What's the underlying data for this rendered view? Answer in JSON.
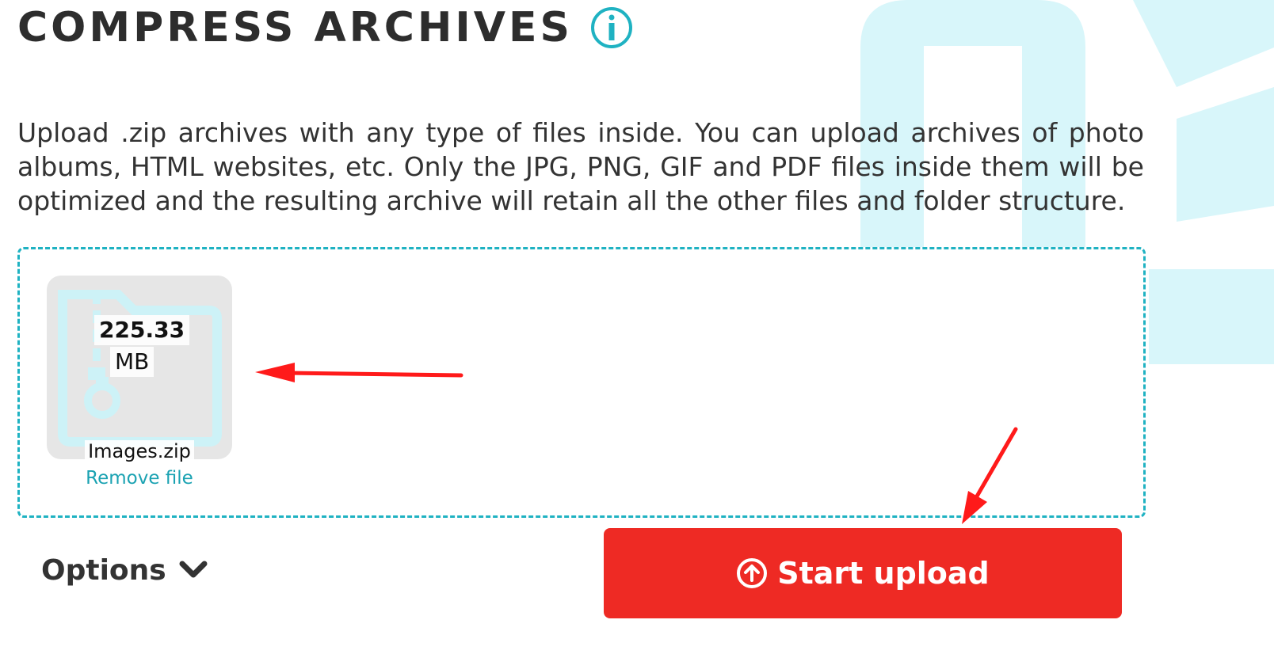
{
  "header": {
    "title": "COMPRESS ARCHIVES",
    "info_icon": "info-circle-icon"
  },
  "description": "Upload .zip archives with any type of files inside. You can upload archives of photo albums, HTML websites, etc. Only the JPG, PNG, GIF and PDF files inside them will be optimized and the resulting archive will retain all the other files and folder structure.",
  "dropzone": {
    "file": {
      "size": "225.33",
      "unit": "MB",
      "name": "Images.zip",
      "remove_label": "Remove file",
      "icon": "zip-folder-icon"
    }
  },
  "options": {
    "label": "Options",
    "icon": "chevron-down-icon"
  },
  "start_upload": {
    "label": "Start upload",
    "icon": "upload-circle-icon"
  },
  "colors": {
    "accent": "#1fb2c2",
    "button": "#ee2a24",
    "annotation": "#ff0000",
    "background_deco": "#d6f5f9"
  }
}
